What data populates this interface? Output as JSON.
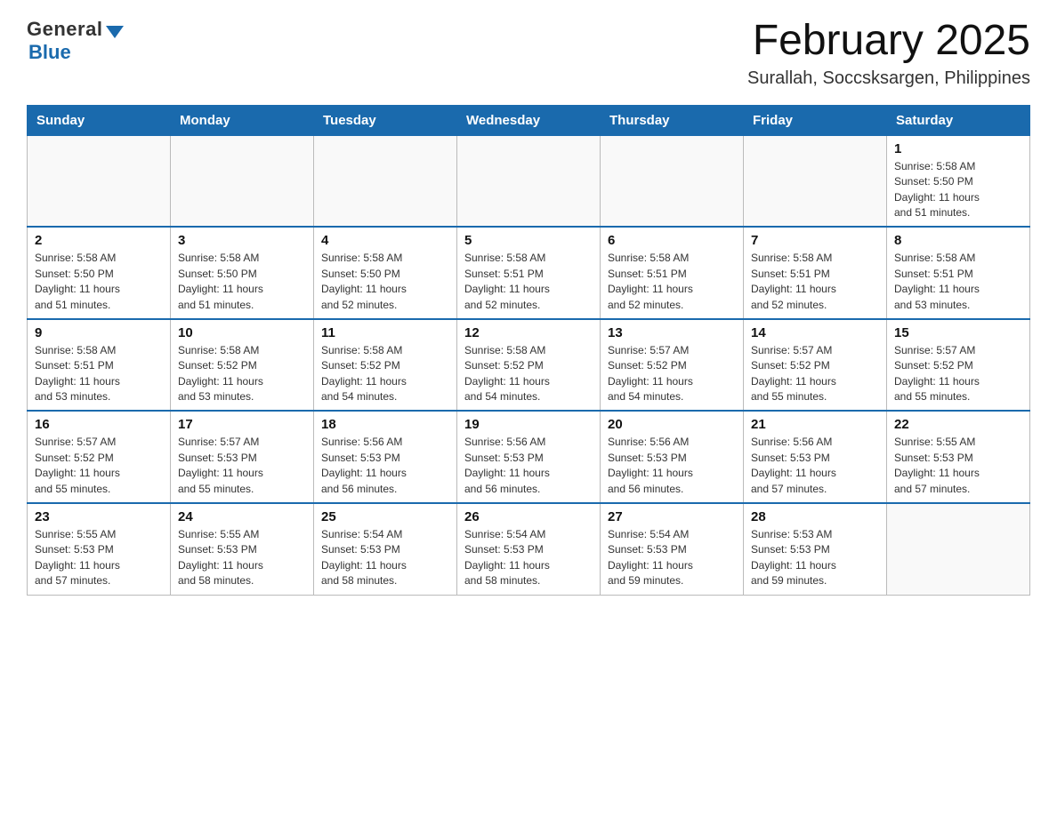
{
  "logo": {
    "general": "General",
    "blue": "Blue"
  },
  "title": "February 2025",
  "location": "Surallah, Soccsksargen, Philippines",
  "days_of_week": [
    "Sunday",
    "Monday",
    "Tuesday",
    "Wednesday",
    "Thursday",
    "Friday",
    "Saturday"
  ],
  "weeks": [
    [
      {
        "day": "",
        "info": ""
      },
      {
        "day": "",
        "info": ""
      },
      {
        "day": "",
        "info": ""
      },
      {
        "day": "",
        "info": ""
      },
      {
        "day": "",
        "info": ""
      },
      {
        "day": "",
        "info": ""
      },
      {
        "day": "1",
        "info": "Sunrise: 5:58 AM\nSunset: 5:50 PM\nDaylight: 11 hours\nand 51 minutes."
      }
    ],
    [
      {
        "day": "2",
        "info": "Sunrise: 5:58 AM\nSunset: 5:50 PM\nDaylight: 11 hours\nand 51 minutes."
      },
      {
        "day": "3",
        "info": "Sunrise: 5:58 AM\nSunset: 5:50 PM\nDaylight: 11 hours\nand 51 minutes."
      },
      {
        "day": "4",
        "info": "Sunrise: 5:58 AM\nSunset: 5:50 PM\nDaylight: 11 hours\nand 52 minutes."
      },
      {
        "day": "5",
        "info": "Sunrise: 5:58 AM\nSunset: 5:51 PM\nDaylight: 11 hours\nand 52 minutes."
      },
      {
        "day": "6",
        "info": "Sunrise: 5:58 AM\nSunset: 5:51 PM\nDaylight: 11 hours\nand 52 minutes."
      },
      {
        "day": "7",
        "info": "Sunrise: 5:58 AM\nSunset: 5:51 PM\nDaylight: 11 hours\nand 52 minutes."
      },
      {
        "day": "8",
        "info": "Sunrise: 5:58 AM\nSunset: 5:51 PM\nDaylight: 11 hours\nand 53 minutes."
      }
    ],
    [
      {
        "day": "9",
        "info": "Sunrise: 5:58 AM\nSunset: 5:51 PM\nDaylight: 11 hours\nand 53 minutes."
      },
      {
        "day": "10",
        "info": "Sunrise: 5:58 AM\nSunset: 5:52 PM\nDaylight: 11 hours\nand 53 minutes."
      },
      {
        "day": "11",
        "info": "Sunrise: 5:58 AM\nSunset: 5:52 PM\nDaylight: 11 hours\nand 54 minutes."
      },
      {
        "day": "12",
        "info": "Sunrise: 5:58 AM\nSunset: 5:52 PM\nDaylight: 11 hours\nand 54 minutes."
      },
      {
        "day": "13",
        "info": "Sunrise: 5:57 AM\nSunset: 5:52 PM\nDaylight: 11 hours\nand 54 minutes."
      },
      {
        "day": "14",
        "info": "Sunrise: 5:57 AM\nSunset: 5:52 PM\nDaylight: 11 hours\nand 55 minutes."
      },
      {
        "day": "15",
        "info": "Sunrise: 5:57 AM\nSunset: 5:52 PM\nDaylight: 11 hours\nand 55 minutes."
      }
    ],
    [
      {
        "day": "16",
        "info": "Sunrise: 5:57 AM\nSunset: 5:52 PM\nDaylight: 11 hours\nand 55 minutes."
      },
      {
        "day": "17",
        "info": "Sunrise: 5:57 AM\nSunset: 5:53 PM\nDaylight: 11 hours\nand 55 minutes."
      },
      {
        "day": "18",
        "info": "Sunrise: 5:56 AM\nSunset: 5:53 PM\nDaylight: 11 hours\nand 56 minutes."
      },
      {
        "day": "19",
        "info": "Sunrise: 5:56 AM\nSunset: 5:53 PM\nDaylight: 11 hours\nand 56 minutes."
      },
      {
        "day": "20",
        "info": "Sunrise: 5:56 AM\nSunset: 5:53 PM\nDaylight: 11 hours\nand 56 minutes."
      },
      {
        "day": "21",
        "info": "Sunrise: 5:56 AM\nSunset: 5:53 PM\nDaylight: 11 hours\nand 57 minutes."
      },
      {
        "day": "22",
        "info": "Sunrise: 5:55 AM\nSunset: 5:53 PM\nDaylight: 11 hours\nand 57 minutes."
      }
    ],
    [
      {
        "day": "23",
        "info": "Sunrise: 5:55 AM\nSunset: 5:53 PM\nDaylight: 11 hours\nand 57 minutes."
      },
      {
        "day": "24",
        "info": "Sunrise: 5:55 AM\nSunset: 5:53 PM\nDaylight: 11 hours\nand 58 minutes."
      },
      {
        "day": "25",
        "info": "Sunrise: 5:54 AM\nSunset: 5:53 PM\nDaylight: 11 hours\nand 58 minutes."
      },
      {
        "day": "26",
        "info": "Sunrise: 5:54 AM\nSunset: 5:53 PM\nDaylight: 11 hours\nand 58 minutes."
      },
      {
        "day": "27",
        "info": "Sunrise: 5:54 AM\nSunset: 5:53 PM\nDaylight: 11 hours\nand 59 minutes."
      },
      {
        "day": "28",
        "info": "Sunrise: 5:53 AM\nSunset: 5:53 PM\nDaylight: 11 hours\nand 59 minutes."
      },
      {
        "day": "",
        "info": ""
      }
    ]
  ]
}
